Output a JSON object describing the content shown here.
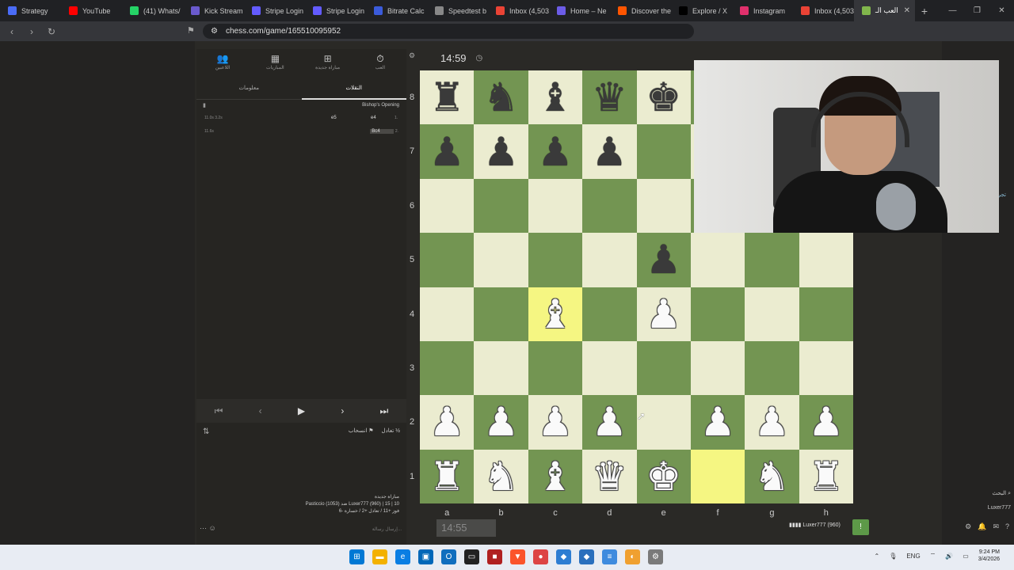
{
  "browser": {
    "tabs": [
      {
        "title": "Strategy",
        "icon": "strategy-icon",
        "color": "#4a6cf7"
      },
      {
        "title": "YouTube",
        "icon": "youtube-icon",
        "color": "#ff0000"
      },
      {
        "title": "(41) Whats/",
        "icon": "whatsapp-icon",
        "color": "#25d366"
      },
      {
        "title": "Kick Stream",
        "icon": "kick-icon",
        "color": "#6a5acd"
      },
      {
        "title": "Stripe Login",
        "icon": "stripe-icon",
        "color": "#635bff"
      },
      {
        "title": "Stripe Login",
        "icon": "stripe-icon",
        "color": "#635bff"
      },
      {
        "title": "Bitrate Calc",
        "icon": "bitrate-icon",
        "color": "#3b5bdb"
      },
      {
        "title": "Speedtest b",
        "icon": "speedtest-icon",
        "color": "#888888"
      },
      {
        "title": "Inbox (4,503",
        "icon": "gmail-icon",
        "color": "#ea4335"
      },
      {
        "title": "Home – Ne",
        "icon": "home-icon",
        "color": "#6c5ce7"
      },
      {
        "title": "Discover the",
        "icon": "soundcloud-icon",
        "color": "#ff5500"
      },
      {
        "title": "Explore / X",
        "icon": "x-icon",
        "color": "#000000"
      },
      {
        "title": "Instagram",
        "icon": "instagram-icon",
        "color": "#e1306c"
      },
      {
        "title": "Inbox (4,503",
        "icon": "gmail-icon",
        "color": "#ea4335"
      },
      {
        "title": "العب الـ",
        "icon": "chess-icon",
        "color": "#81b64c",
        "active": true
      }
    ],
    "url": "chess.com/game/165510095952"
  },
  "panel": {
    "tabs": [
      {
        "label": "اللاعبين",
        "icon": "players-icon"
      },
      {
        "label": "المباريات",
        "icon": "games-icon"
      },
      {
        "label": "مباراة جديدة",
        "icon": "new-game-icon"
      },
      {
        "label": "العب",
        "icon": "play-icon",
        "selected": true
      }
    ],
    "subtabs": {
      "info": "معلومات",
      "moves": "النقلات"
    },
    "opening": "Bishop's Opening",
    "moves": [
      {
        "num": "1.",
        "white": "e4",
        "black": "e5",
        "time_w": "11.0s",
        "time_b": "3.2s"
      },
      {
        "num": "2.",
        "white": "Bc4",
        "black": "",
        "time_w": "11.6s",
        "time_b": ""
      }
    ],
    "actions": {
      "draw": "تعادل",
      "resign": "انسحاب"
    },
    "gameinfo": {
      "title": "مباراة جديدة",
      "line1": "Pasticcio (1053) ضد Luxer777 (960) | 15 | 10",
      "line2": "فوز +11 / تعادل +2 / خسارة -6"
    },
    "chat_placeholder": "إرسال رسالة..."
  },
  "board": {
    "clock_top": "14:59",
    "clock_bottom": "14:55",
    "ranks": [
      "8",
      "7",
      "6",
      "5",
      "4",
      "3",
      "2",
      "1"
    ],
    "files": [
      "a",
      "b",
      "c",
      "d",
      "e",
      "f",
      "g",
      "h"
    ],
    "rows": [
      [
        "br",
        "bn",
        "bb",
        "bq",
        "bk",
        "",
        "",
        ""
      ],
      [
        "bp",
        "bp",
        "bp",
        "bp",
        "",
        "",
        "",
        ""
      ],
      [
        "",
        "",
        "",
        "",
        "",
        "",
        "",
        ""
      ],
      [
        "",
        "",
        "",
        "",
        "bp",
        "",
        "",
        ""
      ],
      [
        "",
        "",
        "wb",
        "",
        "wp",
        "",
        "",
        ""
      ],
      [
        "",
        "",
        "",
        "",
        "",
        "",
        "",
        ""
      ],
      [
        "wp",
        "wp",
        "wp",
        "wp",
        "",
        "wp",
        "wp",
        "wp"
      ],
      [
        "wr",
        "wn",
        "wb",
        "wq",
        "wk",
        "",
        "wn",
        "wr"
      ]
    ],
    "highlight": [
      "c4",
      "f1"
    ],
    "colors": {
      "light": "#ebecd0",
      "dark": "#739552",
      "highlight": "#f5f682"
    }
  },
  "players": {
    "bottom": "Luxer777 (960)",
    "sidebar_user": "Luxer777"
  },
  "sidebar": {
    "trial": "تجربة مجانية",
    "search": "البحث"
  },
  "taskbar": {
    "lang": "ENG",
    "time": "9:24 PM",
    "date": "3/4/2026"
  }
}
